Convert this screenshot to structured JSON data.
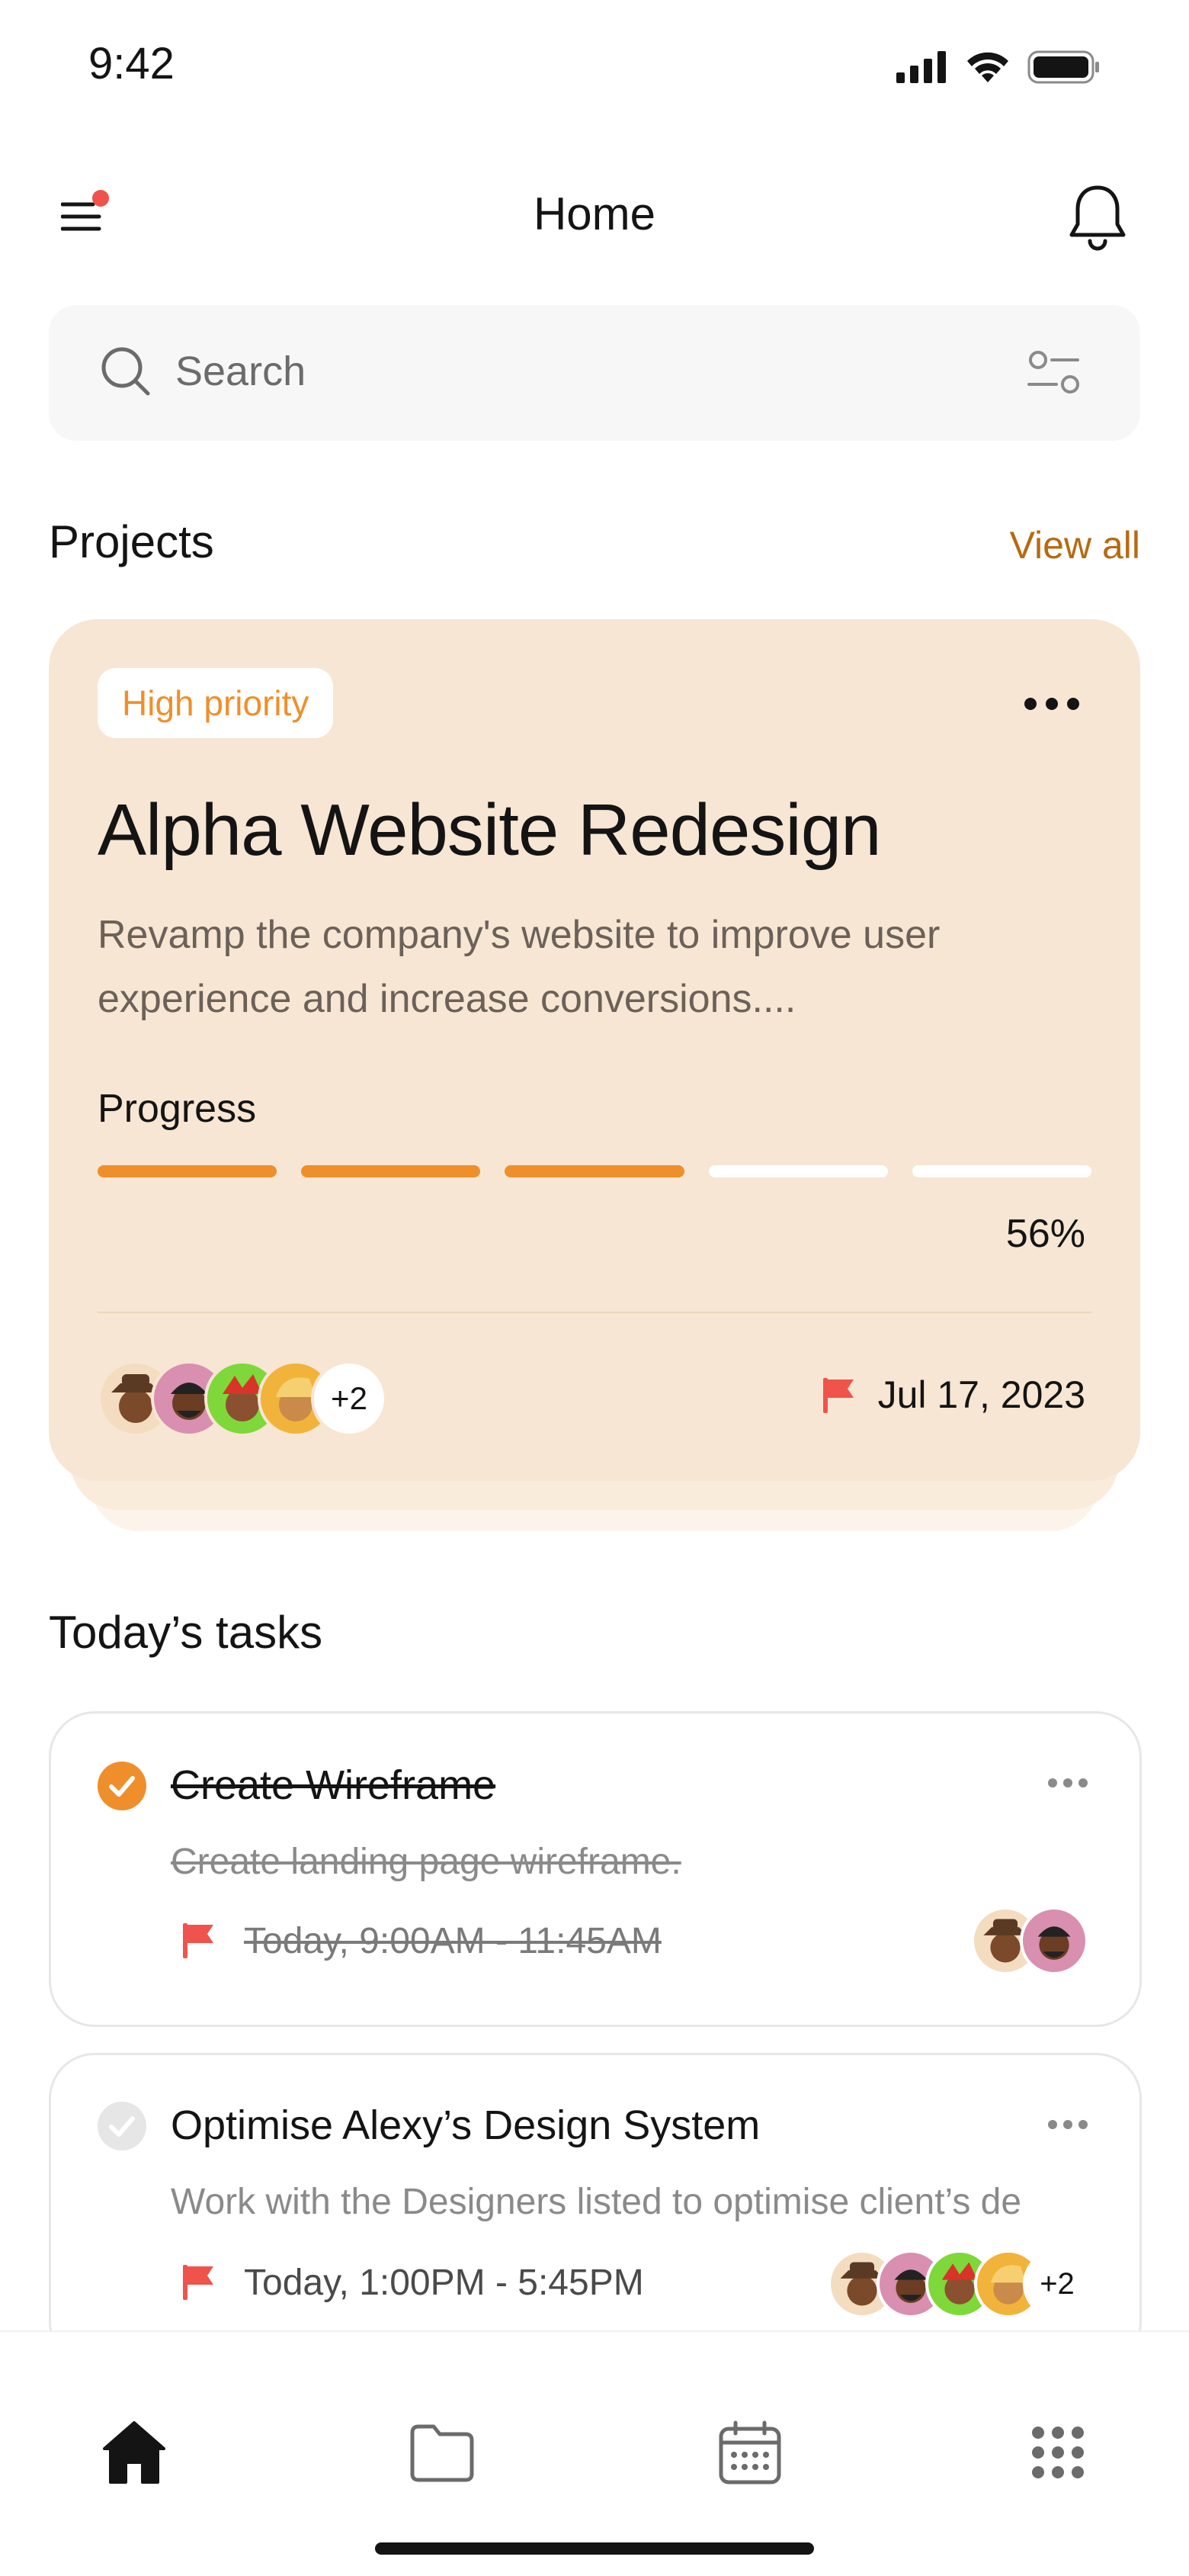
{
  "status_bar": {
    "time": "9:42"
  },
  "header": {
    "title": "Home"
  },
  "search": {
    "placeholder": "Search"
  },
  "projects_section": {
    "title": "Projects",
    "view_all": "View all"
  },
  "project_card": {
    "priority": "High priority",
    "title": "Alpha Website Redesign",
    "description": "Revamp the company's website to improve user experience and increase conversions....",
    "progress_label": "Progress",
    "progress_value": 0.56,
    "progress_text": "56%",
    "progress_segments_filled": 3,
    "progress_segments_total": 5,
    "extra_members": "+2",
    "due_date": "Jul 17, 2023"
  },
  "tasks_section": {
    "title": "Today’s tasks"
  },
  "tasks": [
    {
      "title": "Create Wireframe",
      "subtitle": "Create landing page wireframe.",
      "time": "Today, 9:00AM - 11:45AM",
      "completed": true
    },
    {
      "title": "Optimise Alexy’s Design System",
      "subtitle": "Work with the Designers listed to optimise client’s de...",
      "time": "Today, 1:00PM - 5:45PM",
      "completed": false,
      "extra_members": "+2"
    }
  ],
  "tab_bar": {
    "items": [
      "home-icon",
      "folder-icon",
      "calendar-icon",
      "grid-icon"
    ],
    "active": "home-icon"
  },
  "colors": {
    "accent": "#ef8f2b",
    "card_bg": "#f7e6d3",
    "link": "#b66a12",
    "flag": "#f0534b",
    "notification_dot": "#f0534b"
  }
}
